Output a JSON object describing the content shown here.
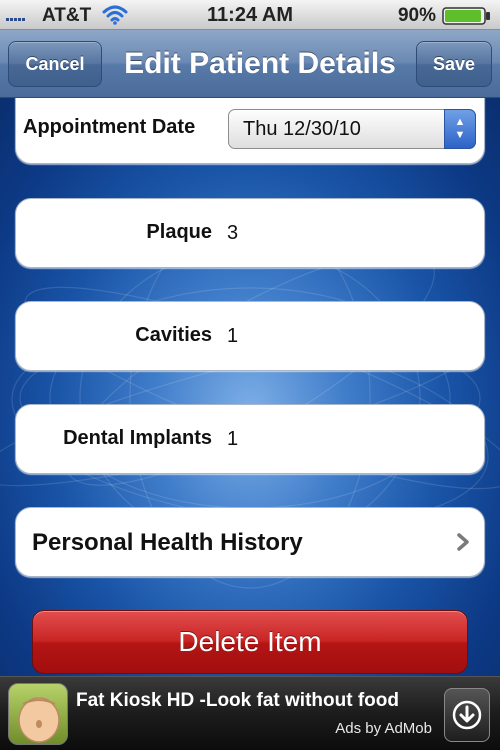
{
  "status_bar": {
    "carrier": "AT&T",
    "time": "11:24 AM",
    "battery": "90%"
  },
  "nav": {
    "cancel_label": "Cancel",
    "title": "Edit Patient Details",
    "save_label": "Save"
  },
  "form": {
    "appointment": {
      "label": "Appointment Date",
      "value": "Thu 12/30/10"
    },
    "plaque": {
      "label": "Plaque",
      "value": "3"
    },
    "cavities": {
      "label": "Cavities",
      "value": "1"
    },
    "implants": {
      "label": "Dental Implants",
      "value": "1"
    },
    "history": {
      "label": "Personal Health History"
    }
  },
  "delete_label": "Delete Item",
  "ad": {
    "title": "Fat Kiosk HD -Look fat without food",
    "attribution": "Ads by AdMob"
  },
  "colors": {
    "nav_blue": "#6b89b3",
    "delete_red": "#c92525",
    "picker_stepper": "#2d63c8",
    "background_blue": "#1a55a8"
  },
  "icons": [
    "signal-icon",
    "wifi-icon",
    "battery-icon",
    "stepper-icon",
    "chevron-right-icon",
    "ad-app-icon",
    "download-icon"
  ]
}
